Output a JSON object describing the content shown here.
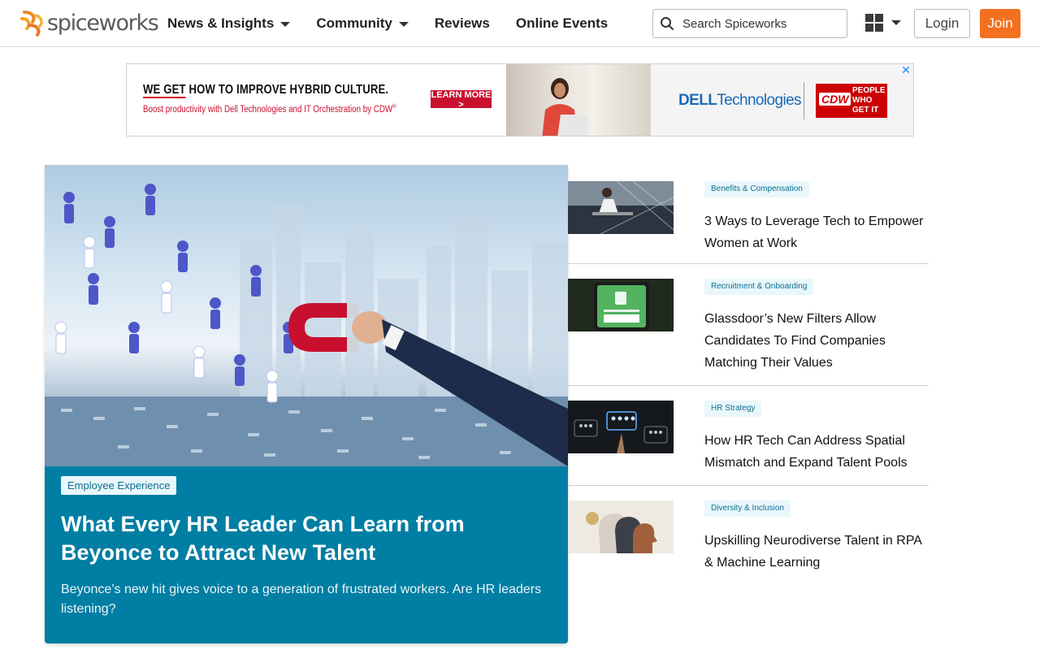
{
  "header": {
    "logo_text": "spiceworks",
    "nav": [
      {
        "label": "News & Insights",
        "has_dropdown": true
      },
      {
        "label": "Community",
        "has_dropdown": true
      },
      {
        "label": "Reviews",
        "has_dropdown": false
      },
      {
        "label": "Online Events",
        "has_dropdown": false
      }
    ],
    "search_placeholder": "Search Spiceworks",
    "login_label": "Login",
    "join_label": "Join",
    "accent_color": "#f37021"
  },
  "ad": {
    "headline_a": "WE GET",
    "headline_b": " HOW TO IMPROVE HYBRID CULTURE.",
    "subline": "Boost productivity with Dell Technologies and IT Orchestration by CDW",
    "subline_mark": "®",
    "cta": "LEARN MORE >",
    "dell_a": "D",
    "dell_b": "ELL",
    "dell_c": "Technologies",
    "cdw_logo": "CDW",
    "cdw_tag_1": "PEOPLE",
    "cdw_tag_2": "WHO",
    "cdw_tag_3": "GET IT",
    "close_symbol": "✕"
  },
  "hero": {
    "tag": "Employee Experience",
    "title": "What Every HR Leader Can Learn from Beyonce to Attract New Talent",
    "description": "Beyonce’s new hit gives voice to a generation of frustrated workers. Are HR leaders listening?",
    "background_color": "#007ea3"
  },
  "stories": [
    {
      "tag": "Benefits & Compensation",
      "title": "3 Ways to Leverage Tech to Empower Women at Work"
    },
    {
      "tag": "Recruitment & Onboarding",
      "title": "Glassdoor’s New Filters Allow Candidates To Find Companies Matching Their Values"
    },
    {
      "tag": "HR Strategy",
      "title": "How HR Tech Can Address Spatial Mismatch and Expand Talent Pools"
    },
    {
      "tag": "Diversity & Inclusion",
      "title": "Upskilling Neurodiverse Talent in RPA & Machine Learning"
    }
  ]
}
